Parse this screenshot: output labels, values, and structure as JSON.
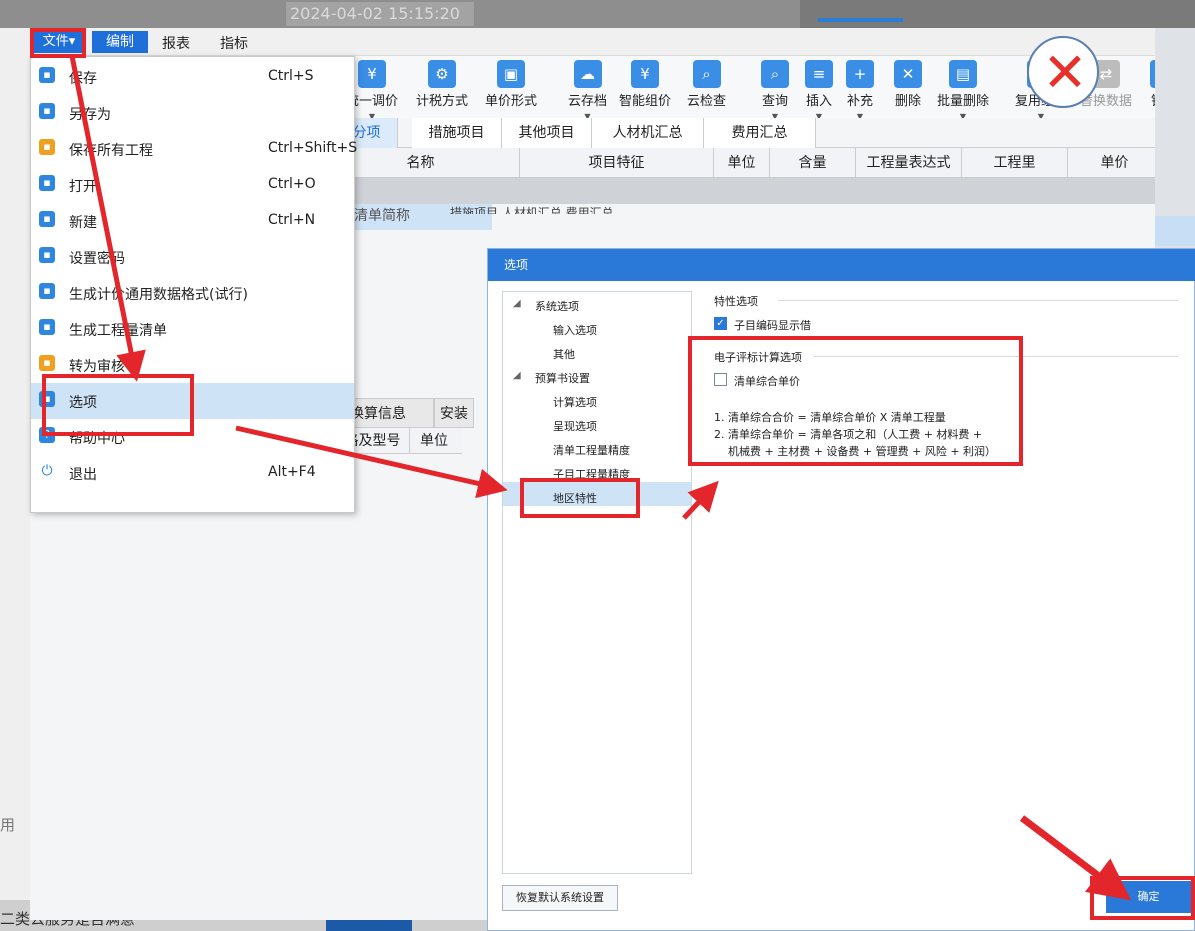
{
  "background": {
    "timestamp": "2024-04-02 15:15:20",
    "left_fragment": "用",
    "bottom_fragment": "二类公服务是否满意"
  },
  "menubar": {
    "file": "文件",
    "edit": "编制",
    "report": "报表",
    "index": "指标"
  },
  "toolbar": {
    "items": [
      {
        "label": "统一调价",
        "icon": "adjust-price-icon"
      },
      {
        "label": "计税方式",
        "icon": "tax-method-icon"
      },
      {
        "label": "单价形式",
        "icon": "unit-price-icon"
      },
      {
        "label": "云存档",
        "icon": "cloud-save-icon"
      },
      {
        "label": "智能组价",
        "icon": "smart-price-icon"
      },
      {
        "label": "云检查",
        "icon": "cloud-check-icon"
      },
      {
        "label": "查询",
        "icon": "query-icon"
      },
      {
        "label": "插入",
        "icon": "insert-icon"
      },
      {
        "label": "补充",
        "icon": "supplement-icon"
      },
      {
        "label": "删除",
        "icon": "delete-icon"
      },
      {
        "label": "批量删除",
        "icon": "batch-delete-icon"
      },
      {
        "label": "复用组价",
        "icon": "reuse-price-icon"
      },
      {
        "label": "替换数据",
        "icon": "replace-data-icon"
      },
      {
        "label": "锁定",
        "icon": "lock-icon"
      }
    ]
  },
  "tabs": [
    "部分项",
    "措施项目",
    "其他项目",
    "人材机汇总",
    "费用汇总"
  ],
  "grid": {
    "headers": [
      "名称",
      "项目特征",
      "单位",
      "含量",
      "工程量表达式",
      "工程里",
      "单价"
    ],
    "row_text": "输入清单简称",
    "row_bits": "措施项目  人材机汇总  费用汇总"
  },
  "lower": {
    "tabs": [
      "换算信息",
      "安装"
    ],
    "headers": [
      "规格及型号",
      "单位"
    ]
  },
  "file_menu": {
    "items": [
      {
        "label": "保存",
        "shortcut": "Ctrl+S",
        "icon": "save-icon"
      },
      {
        "label": "另存为",
        "shortcut": "",
        "icon": "save-as-icon"
      },
      {
        "label": "保存所有工程",
        "shortcut": "Ctrl+Shift+S",
        "icon": "save-all-icon"
      },
      {
        "label": "打开",
        "shortcut": "Ctrl+O",
        "icon": "open-icon"
      },
      {
        "label": "新建",
        "shortcut": "Ctrl+N",
        "icon": "new-icon"
      },
      {
        "label": "设置密码",
        "shortcut": "",
        "icon": "lock-icon"
      },
      {
        "label": "生成计价通用数据格式(试行)",
        "shortcut": "",
        "icon": "export-icon"
      },
      {
        "label": "生成工程量清单",
        "shortcut": "",
        "icon": "list-icon"
      },
      {
        "label": "转为审核",
        "shortcut": "",
        "icon": "audit-icon"
      },
      {
        "label": "选项",
        "shortcut": "",
        "icon": "options-icon"
      },
      {
        "label": "帮助中心",
        "shortcut": "",
        "icon": "help-icon"
      },
      {
        "label": "退出",
        "shortcut": "Alt+F4",
        "icon": "power-icon"
      }
    ]
  },
  "dialog": {
    "title": "选项",
    "tree": {
      "system": "系统选项",
      "input": "输入选项",
      "other": "其他",
      "budget": "预算书设置",
      "calc": "计算选项",
      "display": "呈现选项",
      "list_precision": "清单工程量精度",
      "sub_precision": "子目工程量精度",
      "region": "地区特性"
    },
    "section1": "特性选项",
    "checkbox1": "子目编码显示借",
    "section2": "电子评标计算选项",
    "checkbox2": "清单综合单价",
    "note1": "1. 清单综合合价 = 清单综合单价 X 清单工程量",
    "note2": "2. 清单综合单价 = 清单各项之和（人工费 + 材料费 +",
    "note3": "机械费 + 主材费 + 设备费 + 管理费 + 风险 + 利润）",
    "restore": "恢复默认系统设置",
    "ok": "确定"
  }
}
